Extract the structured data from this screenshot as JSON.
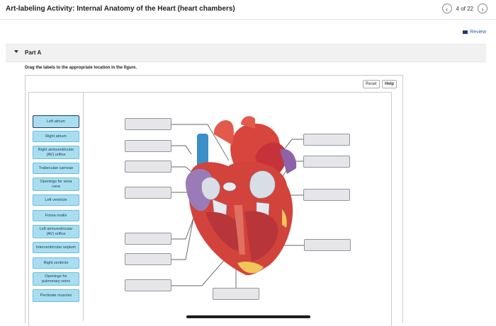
{
  "header": {
    "title": "Art-labeling Activity: Internal Anatomy of the Heart (heart chambers)",
    "prev_icon": "‹",
    "next_icon": "›",
    "page_count": "4 of 22"
  },
  "review_label": "Review",
  "part": {
    "label": "Part A"
  },
  "instructions": "Drag the labels to the appropriate location in the figure.",
  "buttons": {
    "reset": "Reset",
    "help": "Help"
  },
  "label_bank": [
    "Left atrium",
    "Right atrium",
    "Right atrioventricular (AV) orifice",
    "Trabeculae carneae",
    "Openings for vena cava",
    "Left ventricle",
    "Fossa ovalis",
    "Left atrioventricular (AV) orifice",
    "Interventricular septum",
    "Right ventricle",
    "Openings for pulmonary veins",
    "Pectinate muscles"
  ],
  "drop_targets": [
    {
      "name": "target-1",
      "value": ""
    },
    {
      "name": "target-2",
      "value": ""
    },
    {
      "name": "target-3",
      "value": ""
    },
    {
      "name": "target-4",
      "value": ""
    },
    {
      "name": "target-5",
      "value": ""
    },
    {
      "name": "target-6",
      "value": ""
    },
    {
      "name": "target-7",
      "value": ""
    },
    {
      "name": "target-8",
      "value": ""
    },
    {
      "name": "target-9",
      "value": ""
    },
    {
      "name": "target-10",
      "value": ""
    },
    {
      "name": "target-11",
      "value": ""
    },
    {
      "name": "target-12",
      "value": ""
    }
  ],
  "colors": {
    "label_fill": "#a9def1",
    "label_border": "#6bbcdb",
    "heart_red": "#d2433c",
    "vessel_blue": "#3a8fc8"
  }
}
